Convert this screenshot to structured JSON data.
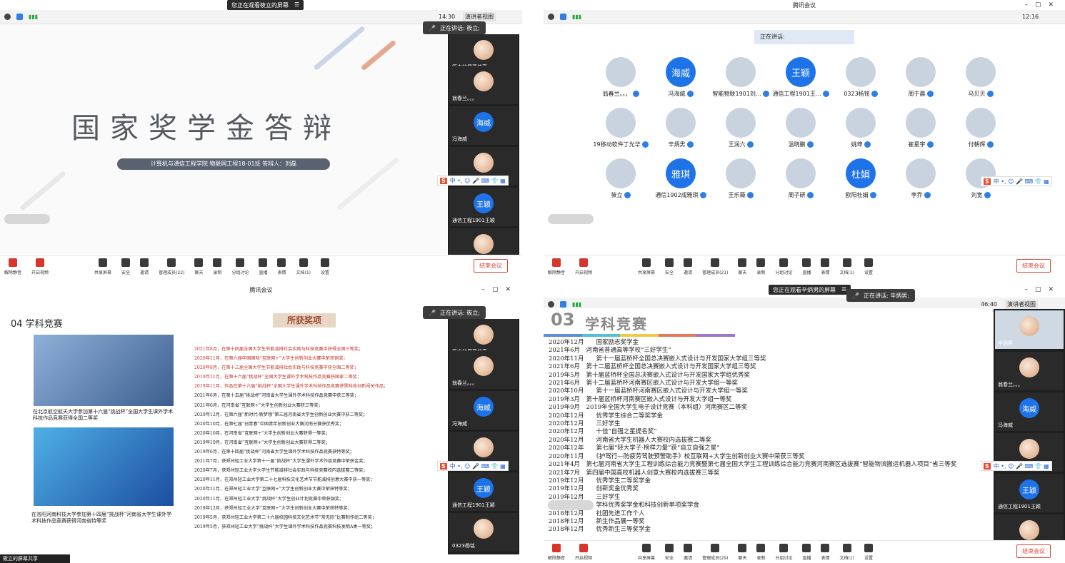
{
  "q1": {
    "banner": "您正在观看筱立的屏幕",
    "time": "14:30",
    "view": "演讲者视图",
    "speaking": "正在讲话: 筱立;",
    "slide_title": "国家奖学金答辩",
    "slide_sub": "计算机与通信工程学院 物联网工程18-01班 答辩人：刘磊",
    "tiles": [
      "筱立的屏幕共享",
      "翁春兰。。。",
      "冯海威",
      "",
      "通信工程1901王颖",
      ""
    ],
    "tile_avatars": [
      "",
      "",
      "海威",
      "",
      "王颖",
      ""
    ],
    "end": "结束会议"
  },
  "toolbar": {
    "items": [
      "解除静音",
      "开启视频",
      "共享屏幕",
      "安全",
      "邀请",
      "管理成员(22)",
      "聊天",
      "录制",
      "分组讨论",
      "直播",
      "表情",
      "文档(1)",
      "设置"
    ],
    "items_q4": [
      "解除静音",
      "开启视频",
      "共享屏幕",
      "安全",
      "邀请",
      "管理成员(29)",
      "聊天",
      "录制",
      "分组讨论",
      "直播",
      "表情",
      "文档(1)",
      "设置"
    ],
    "items_q2": [
      "解除静音",
      "开启视频",
      "共享屏幕",
      "安全",
      "邀请",
      "管理成员(21)",
      "聊天",
      "录制",
      "分组讨论",
      "直播",
      "表情",
      "文档(1)",
      "设置"
    ]
  },
  "ime": {
    "brand": "S",
    "text": "中 •, ☺ 🎤 ⌨ 👕 ▦"
  },
  "q2": {
    "title": "腾讯会议",
    "time": "12:16",
    "speaking": "正在讲话:",
    "participants": [
      {
        "name": "翁春兰。。。",
        "av": ""
      },
      {
        "name": "冯海威",
        "av": "海威"
      },
      {
        "name": "智能物联1901刘...",
        "av": ""
      },
      {
        "name": "通信工程1901王...",
        "av": "王颖"
      },
      {
        "name": "0323杨铭",
        "av": ""
      },
      {
        "name": "周于晨",
        "av": ""
      },
      {
        "name": "马贝贝",
        "av": ""
      },
      {
        "name": "19移动软件丁光华",
        "av": ""
      },
      {
        "name": "辛炳男",
        "av": ""
      },
      {
        "name": "王润六",
        "av": ""
      },
      {
        "name": "温晓鹏",
        "av": ""
      },
      {
        "name": "姚坤",
        "av": ""
      },
      {
        "name": "崔星宇",
        "av": ""
      },
      {
        "name": "付朝辉",
        "av": ""
      },
      {
        "name": "筱立",
        "av": ""
      },
      {
        "name": "通信1902成雅琪",
        "av": "雅琪"
      },
      {
        "name": "王乐薇",
        "av": ""
      },
      {
        "name": "周子研",
        "av": ""
      },
      {
        "name": "欧阳杜娟",
        "av": "杜娟"
      },
      {
        "name": "李乔",
        "av": ""
      },
      {
        "name": "刘宽",
        "av": ""
      }
    ]
  },
  "q3": {
    "title": "腾讯会议",
    "speaking": "正在讲话: 筱立;",
    "heading": "04 学科竞赛",
    "award_title": "所获奖项",
    "caption1": "在北京航空航天大学参加第十六届“挑战杯”全国大学生课外学术科技作品竞赛获得全国二等奖",
    "caption2": "在洛阳河南科技大学参加第十四届“挑战杯”河南省大学生课外学术科技作品竞赛获得河南省特等奖",
    "awards": [
      {
        "t": "2021年8月，在第十四届全国大学生节能减排社会实践与科技竞赛中获得全国三等奖；",
        "red": true
      },
      {
        "t": "2020年11月，在第六届中国国际“互联网+”大学生创新创业大赛中荣获铜奖；",
        "red": true
      },
      {
        "t": "2020年8月，在第十三届全国大学生节能减排社会实践与科技竞赛中获全国二等奖；",
        "red": true
      },
      {
        "t": "2019年11月，在第十六届“挑战杯”全国大学生课外学术科技作品竞赛获国家二等奖；",
        "red": true
      },
      {
        "t": "2019年11月，作品在第十六届“挑战杯”全国大学生课外学术科技作品竞赛获黑科技创新闯关作品；",
        "red": true
      },
      {
        "t": "2021年6月，在第十五届“挑战杯”河南省大学生课外学术科技作品竞赛中获三等奖；",
        "red": false
      },
      {
        "t": "2021年6月，在河南省“互联网+”大学生创新创业大赛获三等奖；",
        "red": false
      },
      {
        "t": "2020年12月，在第六届“新时代·新梦想”第三届河南省大学生创新创业大赛中获二等奖；",
        "red": false
      },
      {
        "t": "2020年10月，在第七届“创青春”中国青年创新创业大赛河南分赛获优秀奖；",
        "red": false
      },
      {
        "t": "2020年10月，在河南省“互联网+”大学生创新创业大赛获得一等奖；",
        "red": false
      },
      {
        "t": "2019年10月，在河南省“互联网+”大学生创新创业大赛获得二等奖；",
        "red": false
      },
      {
        "t": "2019年6月，在第十四届“挑战杯”河南省大学生课外学术科技作品竞赛获特等奖；",
        "red": false
      },
      {
        "t": "2021年7月，获郑州轻工业大学第十一届“挑战杯”大学生课外学术作品竞赛中荣获金奖；",
        "red": false
      },
      {
        "t": "2020年7月，获郑州轻工业大学大学生节能减排社会实践与科技竞赛校内选拔赛二等奖；",
        "red": false
      },
      {
        "t": "2020年11月，在郑州轻工业大学第二十七届科技文化艺术节节能减排创意大赛中获一等奖；",
        "red": false
      },
      {
        "t": "2020年11月，在郑州轻工业大学“互联网+”大学生创新创业大赛中荣获特等奖；",
        "red": false
      },
      {
        "t": "2020年11月，在郑州轻工业大学“挑战杯”大学生创业计划竞赛中荣获银奖；",
        "red": false
      },
      {
        "t": "2019年12月，获郑州轻工业大学“互联网+”大学生创新创业大赛中荣获特等奖；",
        "red": false
      },
      {
        "t": "2019年5月，获郑州轻工业大学第二十六届校园科技文化艺术节“常无际”比赛制作组二等奖；",
        "red": false
      },
      {
        "t": "2019年5月，获郑州轻工业大学“挑战杯”大学生课外学术科技作品竞赛科技发明A类一等奖；",
        "red": false
      }
    ],
    "tiles": [
      "筱立的屏幕共享",
      "翁春兰。。。",
      "冯海威",
      "",
      "通信工程1901王颖",
      "0323杨铭"
    ],
    "tile_avatars": [
      "",
      "",
      "海威",
      "",
      "王颖",
      ""
    ],
    "share": "筱立的屏幕共享"
  },
  "q4": {
    "banner": "您正在观看辛炳男的屏幕",
    "speaking": "正在讲话: 辛炳男;",
    "time": "46:40",
    "view": "演讲者视图",
    "num": "03",
    "heading": "学科竞赛",
    "honors": [
      "2020年12月　　国家励志奖学金",
      "2021年6月　河南省普通高等学校“三好学生”",
      "2020年11月　　第十一届蓝桥杯全国总决赛嵌入式设计与开发国家大学组三等奖",
      "2021年6月　第十二届蓝桥杯全国总决赛嵌入式设计与开发国家大学组三等奖",
      "2019年5月　第十届蓝桥杯全国总决赛嵌入式设计与开发国家大学组优秀奖",
      "2021年6月　第十二届蓝桥杯河南赛区嵌入式设计与开发大学组一等奖",
      "2020年10月　　第十一届蓝桥杯河南赛区嵌入式设计与开发大学组一等奖",
      "2019年3月　第十届蓝桥杯河南赛区嵌入式设计与开发大学组一等奖",
      "2019年9月　2019年全国大学生电子设计竞赛（本科组）河南赛区二等奖",
      "2020年12月　　优秀学生综合二等奖学金",
      "2020年12月　　三好学生",
      "2020年12月　　十佳“自强之星提名奖”",
      "2020年12月　　河南省大学生机器人大赛校内选拔赛二等奖",
      "2020年12年　　第七届“轻大学子·榜样力量”获“自立自强之星”",
      "2020年11月　　《护驾行—防疲劳驾驶预警助手》校互联网+大学生创新创业大赛中荣获三等奖",
      "2021年4月　第七届河南省大学生工程训练综合能力竞赛暨第七届全国大学生工程训练综合能力竞赛河南赛区选拔赛“智能物流搬运机器人项目”省三等奖",
      "2021年7月　第四届中国高校机器人创意大赛校内选拔赛三等奖",
      "2019年12月　　优秀学生二等奖学金",
      "2019年12月　　创新奖金优秀奖",
      "2019年12月　　三好学生",
      "2019年12月　　学科优秀奖学金和科技创新单项奖学金",
      "2018年12月　　社团先进工作个人",
      "2018年12月　　新生作品展一等奖",
      "2018年12月　　优秀新生三等奖学金"
    ],
    "tiles": [
      "辛炳男",
      "翁春兰。。。",
      "冯海威",
      "",
      "通信工程1901王颖",
      ""
    ],
    "tile_avatars": [
      "",
      "",
      "海威",
      "",
      "王颖",
      ""
    ]
  }
}
